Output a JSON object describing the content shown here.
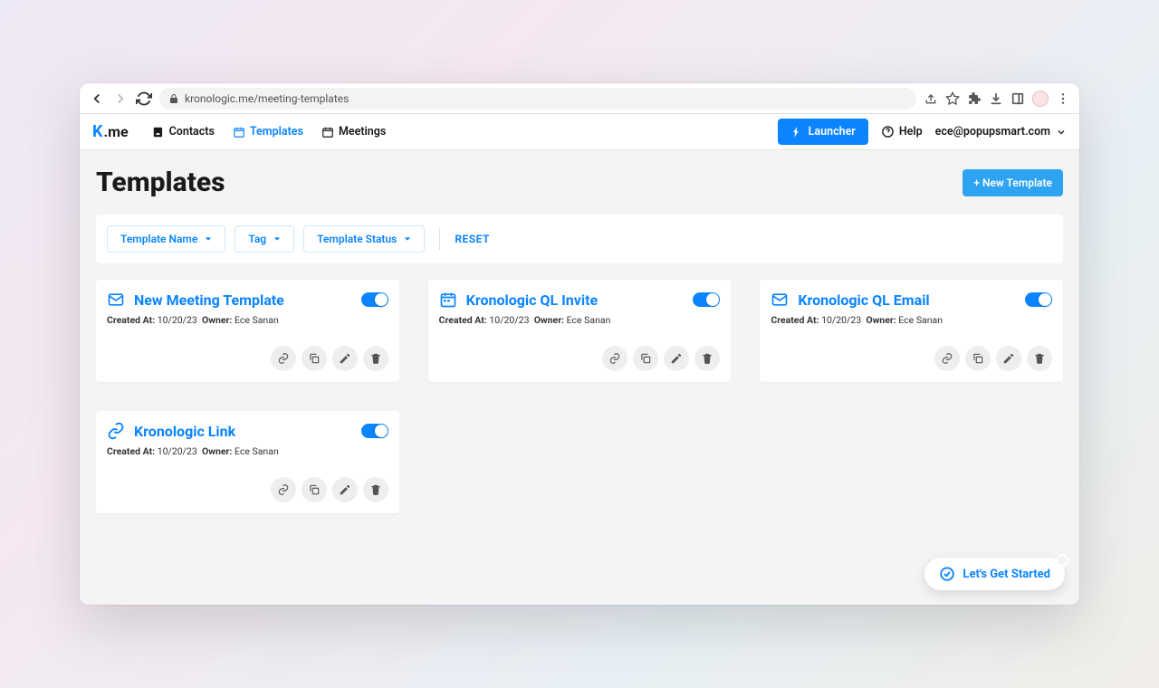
{
  "url": "kronologic.me/meeting-templates",
  "brand_suffix": ".me",
  "nav": {
    "contacts": "Contacts",
    "templates": "Templates",
    "meetings": "Meetings"
  },
  "header": {
    "launcher": "Launcher",
    "help": "Help",
    "user_email": "ece@popupsmart.com"
  },
  "page": {
    "title": "Templates",
    "new_template": "+ New Template"
  },
  "filters": {
    "template_name": "Template Name",
    "tag": "Tag",
    "template_status": "Template Status",
    "reset": "RESET"
  },
  "meta_labels": {
    "created_at": "Created At:",
    "owner": "Owner:"
  },
  "templates": [
    {
      "icon": "mail",
      "title": "New Meeting Template",
      "created_at": "10/20/23",
      "owner": "Ece Sanan"
    },
    {
      "icon": "calendar",
      "title": "Kronologic QL Invite",
      "created_at": "10/20/23",
      "owner": "Ece Sanan"
    },
    {
      "icon": "mail",
      "title": "Kronologic QL Email",
      "created_at": "10/20/23",
      "owner": "Ece Sanan"
    },
    {
      "icon": "link",
      "title": "Kronologic Link",
      "created_at": "10/20/23",
      "owner": "Ece Sanan"
    }
  ],
  "floating": {
    "get_started": "Let's Get Started"
  }
}
